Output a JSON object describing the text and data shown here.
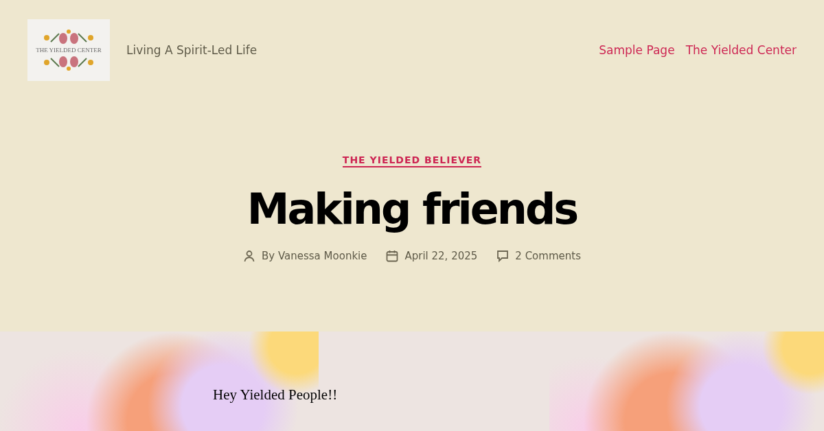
{
  "site": {
    "logo_text": "THE YIELDED CENTER",
    "tagline": "Living A Spirit-Led Life"
  },
  "nav": [
    {
      "label": "Sample Page"
    },
    {
      "label": "The Yielded Center"
    }
  ],
  "post": {
    "category": "THE YIELDED BELIEVER",
    "title": "Making friends",
    "author": "By Vanessa Moonkie",
    "date": "April 22, 2025",
    "comments": "2 Comments"
  },
  "content": {
    "greeting": "Hey Yielded People!!"
  }
}
